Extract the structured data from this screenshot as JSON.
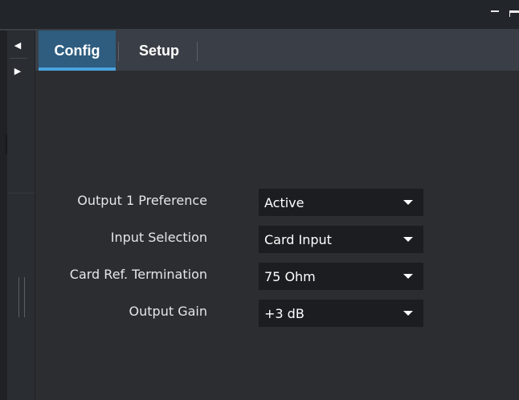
{
  "tabs": {
    "config_label": "Config",
    "setup_label": "Setup"
  },
  "nav": {
    "prev_icon": "◀",
    "next_icon": "▶"
  },
  "form": {
    "rows": [
      {
        "label": "Output 1 Preference",
        "value": "Active"
      },
      {
        "label": "Input Selection",
        "value": "Card Input"
      },
      {
        "label": "Card Ref. Termination",
        "value": "75 Ohm"
      },
      {
        "label": "Output Gain",
        "value": "+3 dB"
      }
    ]
  },
  "colors": {
    "background": "#2b2d31",
    "tabbar": "#3a3f47",
    "active_tab": "#2e5d80",
    "active_tab_underline": "#4aa3df",
    "select_bg": "#1b1d21"
  }
}
